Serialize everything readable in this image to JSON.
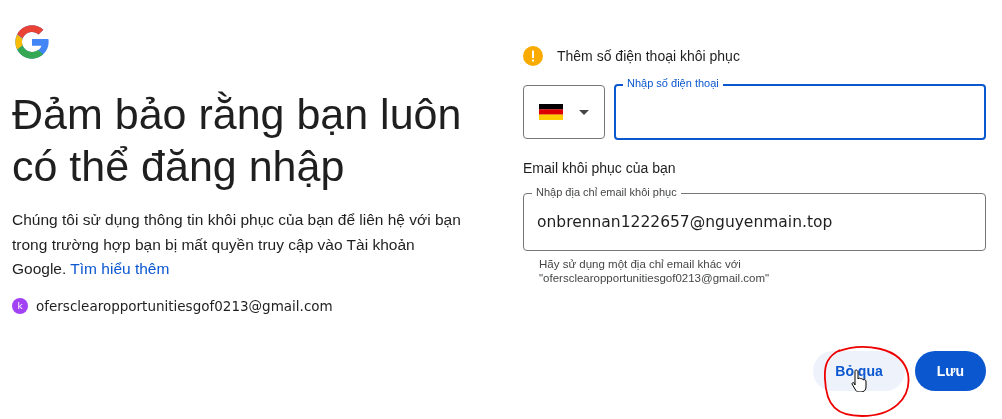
{
  "title_lines": [
    "Đảm bảo rằng bạn luôn",
    "có thể đăng nhập"
  ],
  "description": "Chúng tôi sử dụng thông tin khôi phục của bạn để liên hệ với bạn trong trường hợp bạn bị mất quyền truy cập vào Tài khoản Google.",
  "learn_more_link": "Tìm hiểu thêm",
  "account": {
    "avatar_letter": "k",
    "email": "ofersclearopportunitiesgof0213@gmail.com"
  },
  "phone_section": {
    "warning": "Thêm số điện thoại khôi phục",
    "phone_field": {
      "label": "Nhập số điện thoại",
      "focused": true
    }
  },
  "email_section": {
    "heading": "Email khôi phục của bạn",
    "email_field": {
      "label": "Nhập địa chỉ email khôi phục",
      "value": "onbrennan1222657@nguyenmain.top",
      "focused": false
    },
    "hint_lines": [
      "Hãy sử dụng một địa chỉ email khác với",
      "\"ofersclearopportunitiesgof0213@gmail.com\""
    ]
  },
  "buttons": [
    {
      "label": "Bỏ qua",
      "kind": "text",
      "hovered": true
    },
    {
      "label": "Lưu",
      "kind": "filled",
      "hovered": false
    }
  ]
}
